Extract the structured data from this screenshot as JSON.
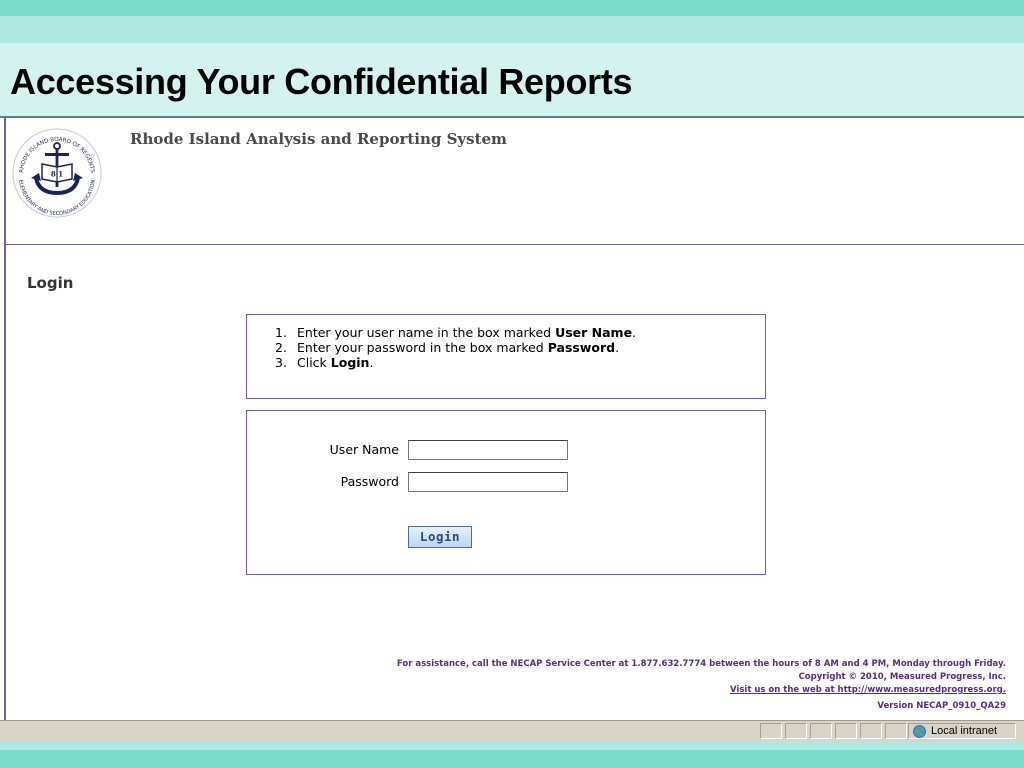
{
  "slide": {
    "title": "Accessing Your Confidential Reports"
  },
  "app": {
    "system_title": "Rhode Island Analysis and Reporting System"
  },
  "logo": {
    "ring_top": "RHODE ISLAND BOARD OF REGENTS",
    "ring_bottom": "ELEMENTARY AND SECONDARY EDUCATION",
    "center": "8 1"
  },
  "login": {
    "heading": "Login",
    "instructions": [
      {
        "num": "1.",
        "pre": "Enter your user name in the box marked ",
        "bold": "User Name",
        "post": "."
      },
      {
        "num": "2.",
        "pre": "Enter your password in the box marked ",
        "bold": "Password",
        "post": "."
      },
      {
        "num": "3.",
        "pre": "Click ",
        "bold": "Login",
        "post": "."
      }
    ],
    "username_label": "User Name",
    "username_value": "",
    "password_label": "Password",
    "password_value": "",
    "button_label": "Login"
  },
  "footer": {
    "assistance": "For assistance, call the NECAP Service Center at 1.877.632.7774 between the hours of 8 AM and 4 PM, Monday through Friday.",
    "copyright": "Copyright © 2010, Measured Progress, Inc.",
    "link_text": "Visit us on the web at http://www.measuredprogress.org.",
    "version": "Version NECAP_0910_QA29"
  },
  "statusbar": {
    "zone_icon": "globe-icon",
    "zone_label": "Local intranet"
  },
  "colors": {
    "band_dark": "#7ddbcc",
    "band_light": "#ade9e0",
    "slide_bg": "#d5f3ee",
    "accent_purple": "#7b5aa0"
  }
}
